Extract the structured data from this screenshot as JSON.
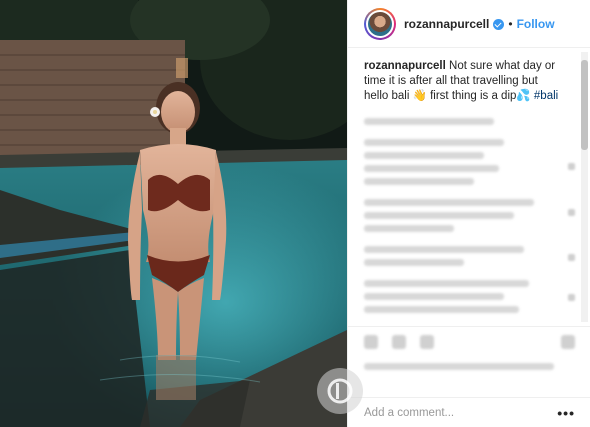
{
  "post": {
    "username": "rozannapurcell",
    "separator": "•",
    "follow_label": "Follow",
    "caption_username": "rozannapurcell",
    "caption_text": " Not sure what day or time it is after all that travelling but hello bali 👋 first thing is a dip💦 ",
    "caption_hashtag": "#bali"
  },
  "add_comment": {
    "placeholder": "Add a comment...",
    "more_label": "•••"
  },
  "icons": {
    "verified": "verified-badge-icon",
    "more": "more-options-icon",
    "watermark": "watermark-logo"
  },
  "colors": {
    "accent": "#3897f0",
    "hashtag": "#003569",
    "text": "#262626",
    "placeholder": "#999999"
  }
}
